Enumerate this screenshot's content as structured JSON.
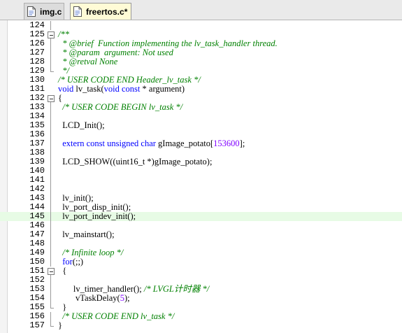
{
  "tabs": [
    {
      "label": "img.c",
      "icon": "c-file-icon",
      "active": false
    },
    {
      "label": "freertos.c*",
      "icon": "c-file-icon",
      "active": true
    }
  ],
  "colors": {
    "comment": "#008000",
    "keyword": "#0000ff",
    "number": "#8000ff",
    "highlight": "#e7fbe5"
  },
  "code_lines": [
    {
      "n": "124",
      "fold": "line",
      "segments": []
    },
    {
      "n": "125",
      "fold": "box",
      "segments": [
        {
          "t": "/**",
          "s": "cm"
        }
      ]
    },
    {
      "n": "126",
      "fold": "line",
      "segments": [
        {
          "t": "  * @brief  Function implementing the lv_task_handler thread.",
          "s": "cm"
        }
      ]
    },
    {
      "n": "127",
      "fold": "line",
      "segments": [
        {
          "t": "  * @param  argument: Not used",
          "s": "cm"
        }
      ]
    },
    {
      "n": "128",
      "fold": "line",
      "segments": [
        {
          "t": "  * @retval None",
          "s": "cm"
        }
      ]
    },
    {
      "n": "129",
      "fold": "end",
      "segments": [
        {
          "t": "  */",
          "s": "cm"
        }
      ]
    },
    {
      "n": "130",
      "fold": "",
      "segments": [
        {
          "t": "/* USER CODE END Header_lv_task */",
          "s": "cm"
        }
      ]
    },
    {
      "n": "131",
      "fold": "",
      "segments": [
        {
          "t": "void",
          "s": "kw"
        },
        {
          "t": " lv_task(",
          "s": ""
        },
        {
          "t": "void",
          "s": "kw"
        },
        {
          "t": " ",
          "s": ""
        },
        {
          "t": "const",
          "s": "kw"
        },
        {
          "t": " * argument)",
          "s": ""
        }
      ]
    },
    {
      "n": "132",
      "fold": "box",
      "segments": [
        {
          "t": "{",
          "s": ""
        }
      ]
    },
    {
      "n": "133",
      "fold": "line",
      "segments": [
        {
          "t": "  /* USER CODE BEGIN lv_task */",
          "s": "cm"
        }
      ]
    },
    {
      "n": "134",
      "fold": "line",
      "segments": []
    },
    {
      "n": "135",
      "fold": "line",
      "segments": [
        {
          "t": "  LCD_Init();",
          "s": ""
        }
      ]
    },
    {
      "n": "136",
      "fold": "line",
      "segments": []
    },
    {
      "n": "137",
      "fold": "line",
      "segments": [
        {
          "t": "  ",
          "s": ""
        },
        {
          "t": "extern",
          "s": "kw"
        },
        {
          "t": " ",
          "s": ""
        },
        {
          "t": "const",
          "s": "kw"
        },
        {
          "t": " ",
          "s": ""
        },
        {
          "t": "unsigned",
          "s": "kw"
        },
        {
          "t": " ",
          "s": ""
        },
        {
          "t": "char",
          "s": "kw"
        },
        {
          "t": " gImage_potato[",
          "s": ""
        },
        {
          "t": "153600",
          "s": "num"
        },
        {
          "t": "];",
          "s": ""
        }
      ]
    },
    {
      "n": "138",
      "fold": "line",
      "segments": []
    },
    {
      "n": "139",
      "fold": "line",
      "segments": [
        {
          "t": "  LCD_SHOW((uint16_t *)gImage_potato);",
          "s": ""
        }
      ]
    },
    {
      "n": "140",
      "fold": "line",
      "segments": []
    },
    {
      "n": "141",
      "fold": "line",
      "segments": []
    },
    {
      "n": "142",
      "fold": "line",
      "segments": []
    },
    {
      "n": "143",
      "fold": "line",
      "segments": [
        {
          "t": "  lv_init();",
          "s": ""
        }
      ]
    },
    {
      "n": "144",
      "fold": "line",
      "segments": [
        {
          "t": "  lv_port_disp_init();",
          "s": ""
        }
      ]
    },
    {
      "n": "145",
      "fold": "line",
      "hl": true,
      "segments": [
        {
          "t": "  lv_port_indev_init();",
          "s": ""
        }
      ]
    },
    {
      "n": "146",
      "fold": "line",
      "segments": []
    },
    {
      "n": "147",
      "fold": "line",
      "segments": [
        {
          "t": "  lv_mainstart();",
          "s": ""
        }
      ]
    },
    {
      "n": "148",
      "fold": "line",
      "segments": []
    },
    {
      "n": "149",
      "fold": "line",
      "segments": [
        {
          "t": "  /* Infinite loop */",
          "s": "cm"
        }
      ]
    },
    {
      "n": "150",
      "fold": "line",
      "segments": [
        {
          "t": "  ",
          "s": ""
        },
        {
          "t": "for",
          "s": "kw"
        },
        {
          "t": "(;;)",
          "s": ""
        }
      ]
    },
    {
      "n": "151",
      "fold": "box",
      "segments": [
        {
          "t": "  {",
          "s": ""
        }
      ]
    },
    {
      "n": "152",
      "fold": "line",
      "segments": []
    },
    {
      "n": "153",
      "fold": "line",
      "segments": [
        {
          "t": "       lv_timer_handler(); ",
          "s": ""
        },
        {
          "t": "/* LVGL计时器 */",
          "s": "cm"
        }
      ]
    },
    {
      "n": "154",
      "fold": "line",
      "segments": [
        {
          "t": "        vTaskDelay(",
          "s": ""
        },
        {
          "t": "5",
          "s": "num"
        },
        {
          "t": ");",
          "s": ""
        }
      ]
    },
    {
      "n": "155",
      "fold": "end",
      "segments": [
        {
          "t": "  }",
          "s": ""
        }
      ]
    },
    {
      "n": "156",
      "fold": "line",
      "segments": [
        {
          "t": "  /* USER CODE END lv_task */",
          "s": "cm"
        }
      ]
    },
    {
      "n": "157",
      "fold": "end",
      "segments": [
        {
          "t": "}",
          "s": ""
        }
      ]
    }
  ]
}
